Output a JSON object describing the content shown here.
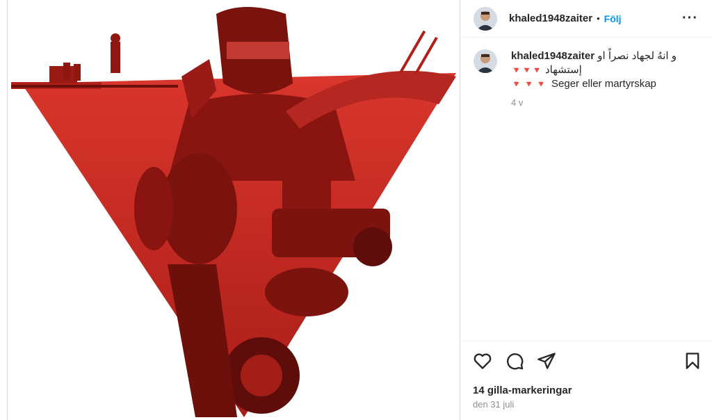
{
  "post": {
    "username": "khaled1948zaiter",
    "follow_label": "Följ",
    "separator": "•",
    "more_label": "···"
  },
  "comment": {
    "username": "khaled1948zaiter",
    "arabic_text": "و انهُ لجهاد نصراً او",
    "arabic_text_2": "إستشهاد",
    "triangles_1": "🔻🔻🔻",
    "triangles_2": "🔻🔻🔻",
    "swedish_text": "Seger eller martyrskap",
    "time": "4 v"
  },
  "engagement": {
    "likes": "14 gilla-markeringar",
    "date": "den 31 juli"
  },
  "colors": {
    "accent": "#0095f6",
    "image_red": "#c0251e"
  },
  "icons": [
    "heart-icon",
    "comment-icon",
    "share-icon",
    "bookmark-icon"
  ]
}
